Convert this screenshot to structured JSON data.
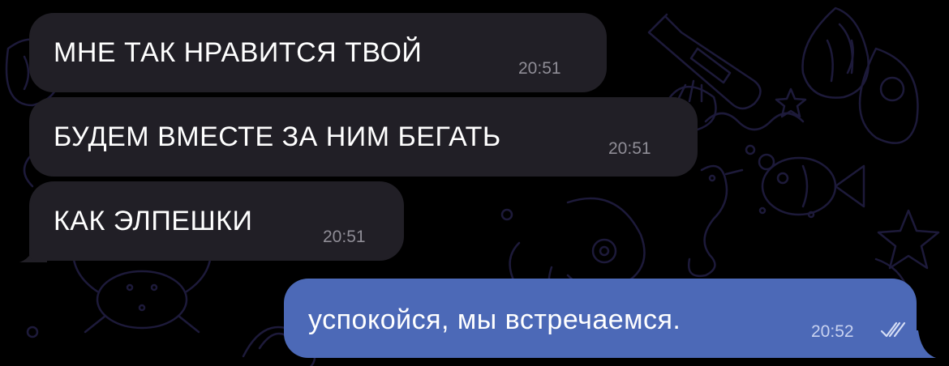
{
  "messages": [
    {
      "direction": "incoming",
      "text": "МНЕ ТАК НРАВИТСЯ ТВОЙ",
      "time": "20:51"
    },
    {
      "direction": "incoming",
      "text": "БУДЕМ ВМЕСТЕ ЗА НИМ БЕГАТЬ",
      "time": "20:51"
    },
    {
      "direction": "incoming",
      "text": "КАК ЭЛПЕШКИ",
      "time": "20:51"
    },
    {
      "direction": "outgoing",
      "text": "успокойся, мы встречаемся.",
      "time": "20:52",
      "status": "read-double-check"
    }
  ],
  "colors": {
    "background": "#000000",
    "incoming_bubble": "#211f26",
    "outgoing_bubble": "#4c69b7",
    "doodle_lines": "#1c1838"
  }
}
